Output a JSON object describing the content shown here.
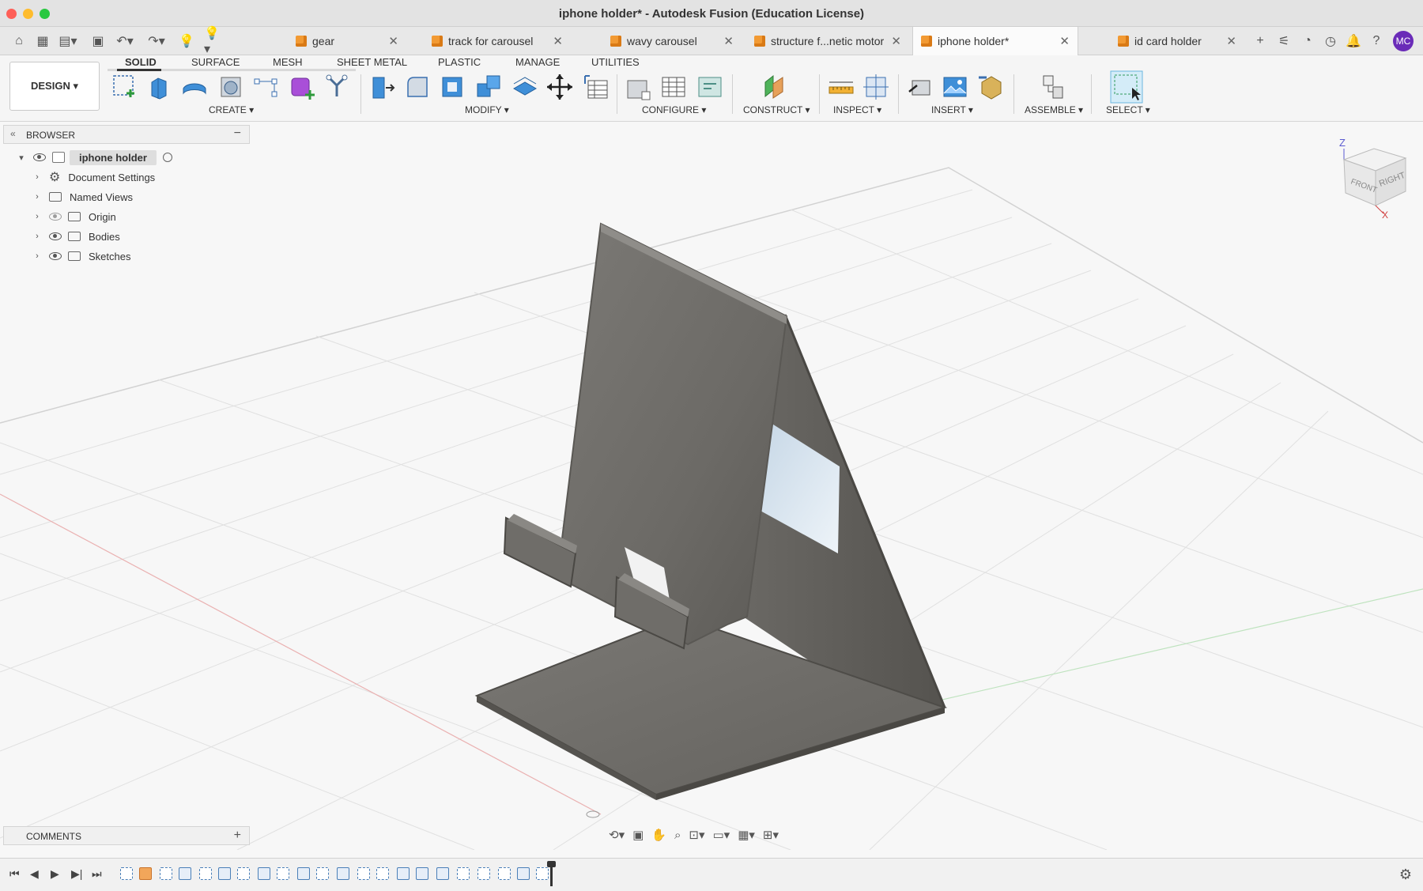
{
  "window": {
    "title": "iphone holder* - Autodesk Fusion (Education License)"
  },
  "doc_tabs": [
    {
      "label": "gear",
      "active": false
    },
    {
      "label": "track for carousel",
      "active": false
    },
    {
      "label": "wavy carousel",
      "active": false
    },
    {
      "label": "structure f...netic motor",
      "active": false
    },
    {
      "label": "iphone holder*",
      "active": true
    },
    {
      "label": "id card holder",
      "active": false
    }
  ],
  "user": {
    "initials": "MC"
  },
  "toolbar": {
    "workspace_button": "DESIGN ▾",
    "workspace_tabs": [
      "SOLID",
      "SURFACE",
      "MESH",
      "SHEET METAL",
      "PLASTIC",
      "MANAGE",
      "UTILITIES"
    ],
    "active_tab": "SOLID",
    "groups": [
      "CREATE ▾",
      "MODIFY ▾",
      "CONFIGURE ▾",
      "CONSTRUCT ▾",
      "INSPECT ▾",
      "INSERT ▾",
      "ASSEMBLE ▾",
      "SELECT ▾"
    ]
  },
  "browser": {
    "header": "BROWSER",
    "root": "iphone holder",
    "items": [
      {
        "label": "Document Settings",
        "icon": "gear-icon"
      },
      {
        "label": "Named Views",
        "icon": "folder-icon"
      },
      {
        "label": "Origin",
        "icon": "folder-icon",
        "visible": false
      },
      {
        "label": "Bodies",
        "icon": "folder-icon",
        "visible": true
      },
      {
        "label": "Sketches",
        "icon": "folder-icon",
        "visible": true
      }
    ]
  },
  "viewcube": {
    "top": "Z",
    "front": "FRONT",
    "right": "RIGHT",
    "axis_x": "X"
  },
  "comments": {
    "label": "COMMENTS"
  },
  "colors": {
    "accent": "#0696d7",
    "model": "#6f6d69",
    "tab_icon": "#f29a33",
    "avatar": "#6a2bb8"
  }
}
